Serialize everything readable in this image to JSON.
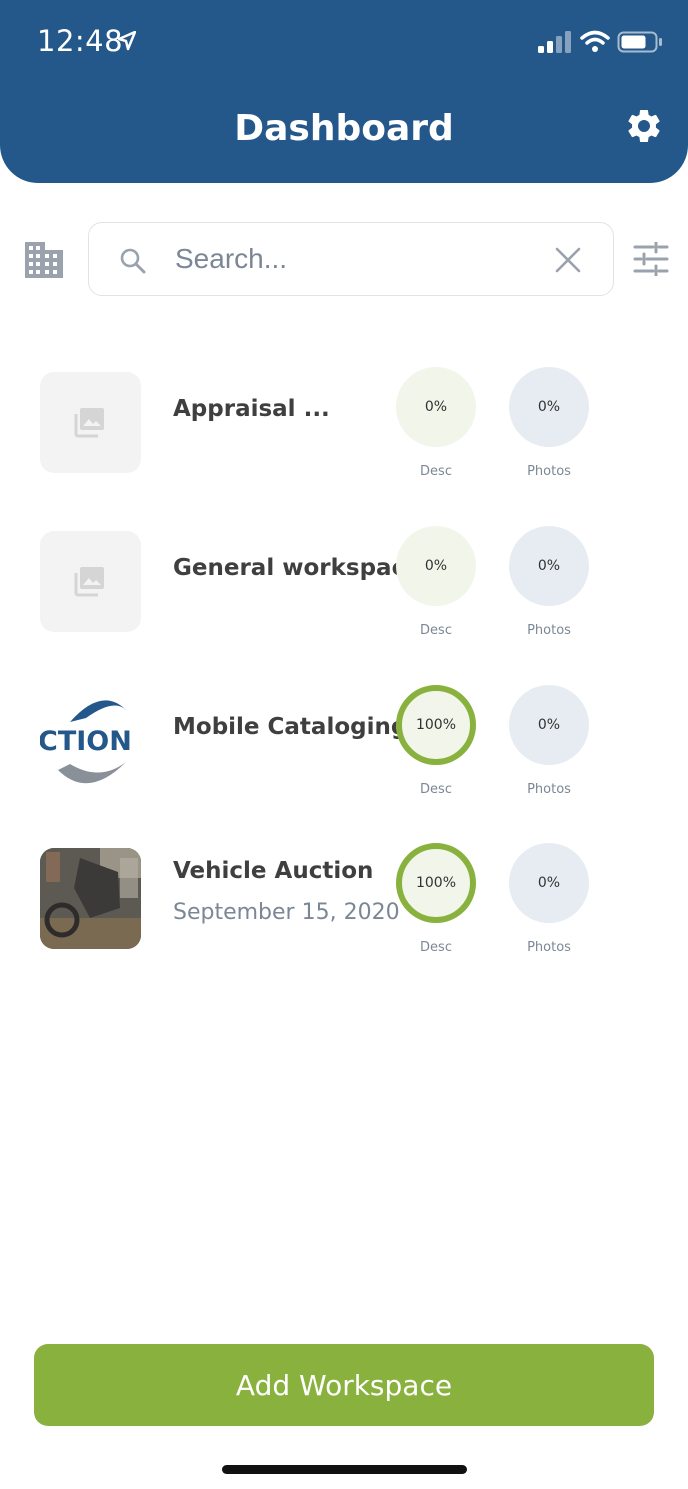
{
  "status_bar": {
    "time": "12:48"
  },
  "header": {
    "title": "Dashboard"
  },
  "search": {
    "placeholder": "Search..."
  },
  "workspaces": [
    {
      "name": "Appraisal ...",
      "date": "",
      "thumb": "placeholder",
      "desc": "0%",
      "desc_level": 0,
      "photos": "0%",
      "desc_label": "Desc",
      "photos_label": "Photos"
    },
    {
      "name": "General workspace",
      "date": "",
      "thumb": "placeholder",
      "desc": "0%",
      "desc_level": 0,
      "photos": "0%",
      "desc_label": "Desc",
      "photos_label": "Photos"
    },
    {
      "name": "Mobile Cataloging ...",
      "date": "",
      "thumb": "logo",
      "logo_text": "CTION",
      "desc": "100%",
      "desc_level": 100,
      "photos": "0%",
      "desc_label": "Desc",
      "photos_label": "Photos"
    },
    {
      "name": "Vehicle Auction",
      "date": "September 15, 2020",
      "thumb": "photo",
      "desc": "100%",
      "desc_level": 100,
      "photos": "0%",
      "desc_label": "Desc",
      "photos_label": "Photos"
    }
  ],
  "actions": {
    "add_workspace": "Add Workspace"
  },
  "colors": {
    "header": "#24578a",
    "accent": "#88b13d",
    "desc_bg": "#f1f5ea",
    "photos_bg": "#e6ecf2"
  }
}
